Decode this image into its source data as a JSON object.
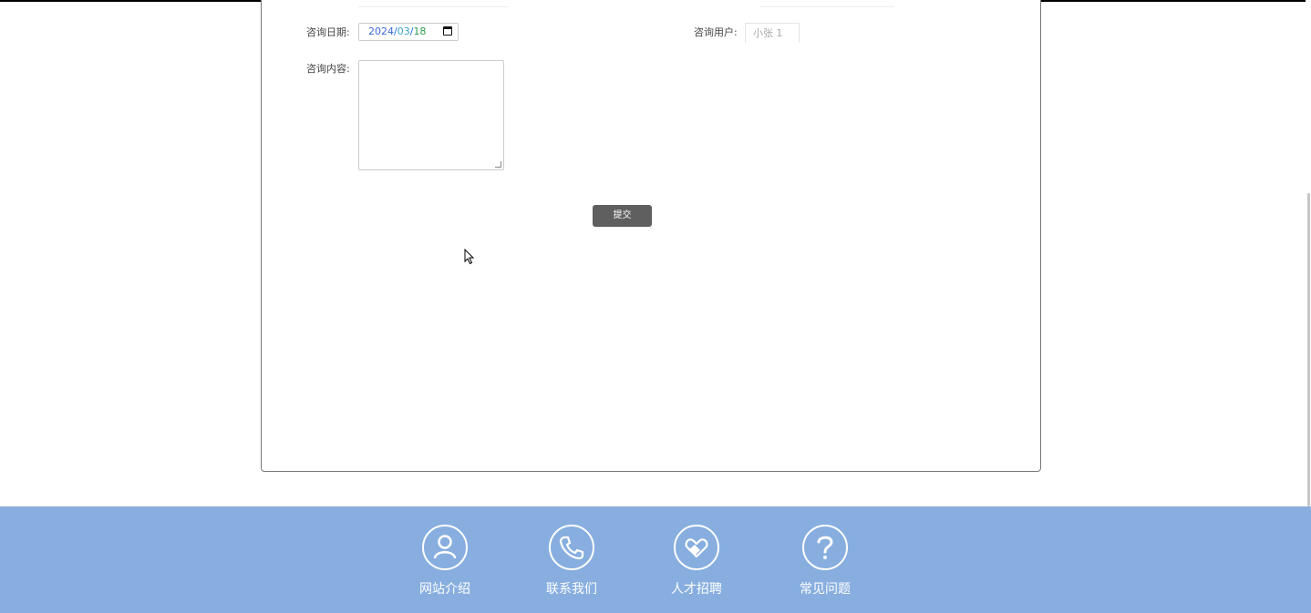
{
  "form": {
    "date_label": "咨询日期:",
    "date_value": {
      "year": "2024",
      "sep1": "/",
      "month": "03",
      "sep2": "/",
      "day": "18"
    },
    "user_label": "咨询用户:",
    "user_value": "小张 1",
    "content_label": "咨询内容:",
    "content_value": "",
    "submit_label": "提交"
  },
  "footer": {
    "items": [
      {
        "label": "网站介绍",
        "icon": "person-icon"
      },
      {
        "label": "联系我们",
        "icon": "phone-icon"
      },
      {
        "label": "人才招聘",
        "icon": "handshake-heart-icon"
      },
      {
        "label": "常见问题",
        "icon": "question-icon"
      }
    ]
  },
  "colors": {
    "footer_bg": "#87aedf",
    "button_bg": "#5f5f5f"
  }
}
